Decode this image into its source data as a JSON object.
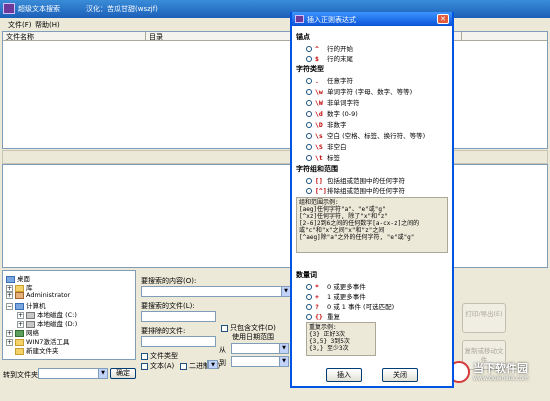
{
  "window": {
    "title": "超级文本搜索",
    "credit": "汉化：苦瓜甘甜(wszjf)"
  },
  "menu": {
    "file": "文件(F)",
    "help": "帮助(H)"
  },
  "results": {
    "col_filename": "文件名称",
    "col_path": "目录"
  },
  "tree": {
    "desktop": "桌面",
    "library": "库",
    "user": "Administrator",
    "computer": "计算机",
    "drive_c": "本地磁盘 (C:)",
    "drive_d": "本地磁盘 (D:)",
    "network": "网络",
    "tools": "WIN7激活工具",
    "new_folder": "新建文件夹"
  },
  "search": {
    "content_label": "要搜索的内容(O):",
    "files_label": "要搜索的文件(L):",
    "exclude_label": "要排除的文件:",
    "filetype_label": "文件类型",
    "text_label": "文本(A)",
    "binary_label": "二进制(B)",
    "only_files_label": "只包含文件(D)",
    "date_range_label": "使用日期范围",
    "from_label": "从",
    "to_label": "到"
  },
  "goto": {
    "label": "转到文件夹",
    "button": "确定"
  },
  "side_buttons": {
    "print": "打印/导出(E)",
    "copy": "复制或移动文件"
  },
  "dialog": {
    "title": "插入正则表达式",
    "anchor_title": "锚点",
    "anchors": [
      {
        "sym": "^",
        "desc": "行的开始"
      },
      {
        "sym": "$",
        "desc": "行的末尾"
      }
    ],
    "char_title": "字符类型",
    "chars": [
      {
        "sym": ".",
        "desc": "任意字符"
      },
      {
        "sym": "\\w",
        "desc": "单词字符 (字母、数字、等等)"
      },
      {
        "sym": "\\W",
        "desc": "非单词字符"
      },
      {
        "sym": "\\d",
        "desc": "数字 (0-9)"
      },
      {
        "sym": "\\D",
        "desc": "非数字"
      },
      {
        "sym": "\\s",
        "desc": "空白 (空格、标签、换行符、等等)"
      },
      {
        "sym": "\\S",
        "desc": "非空白"
      },
      {
        "sym": "\\t",
        "desc": "标签"
      }
    ],
    "group_title": "字符组和范围",
    "groups": [
      {
        "sym": "[]",
        "desc": "包括组或范围中的任何字符"
      },
      {
        "sym": "[^]",
        "desc": "排除组或范围中的任何字符"
      }
    ],
    "group_example_title": "组和范围示例:",
    "group_examples": [
      "[aeg]任何字符\"a\"、\"e\"或\"g\"",
      "[^xz]任何字符, 除了\"x\"和\"z\"",
      "[2-6]2到6之间的任何数字[a-cx-z]之间的",
      "或\"c\"和\"x\"之间\"x\"和\"z\"之间",
      "[^aeg]除\"a\"之外的任何字符, \"e\"或\"g\""
    ],
    "quant_title": "数量词",
    "quants": [
      {
        "sym": "*",
        "desc": "0 或更多事件"
      },
      {
        "sym": "+",
        "desc": "1 或更多事件"
      },
      {
        "sym": "?",
        "desc": "0 或 1 事件 (可选匹配)"
      },
      {
        "sym": "{}",
        "desc": "重复"
      }
    ],
    "repeat_example_title": "重复示例:",
    "repeat_examples": [
      "{3} 正好3次",
      "{3,5} 3到5次",
      "{3,} 至少3次"
    ],
    "insert": "插入",
    "close": "关闭"
  },
  "watermark": {
    "name": "当下软件园",
    "url": "www.downxia.com"
  }
}
